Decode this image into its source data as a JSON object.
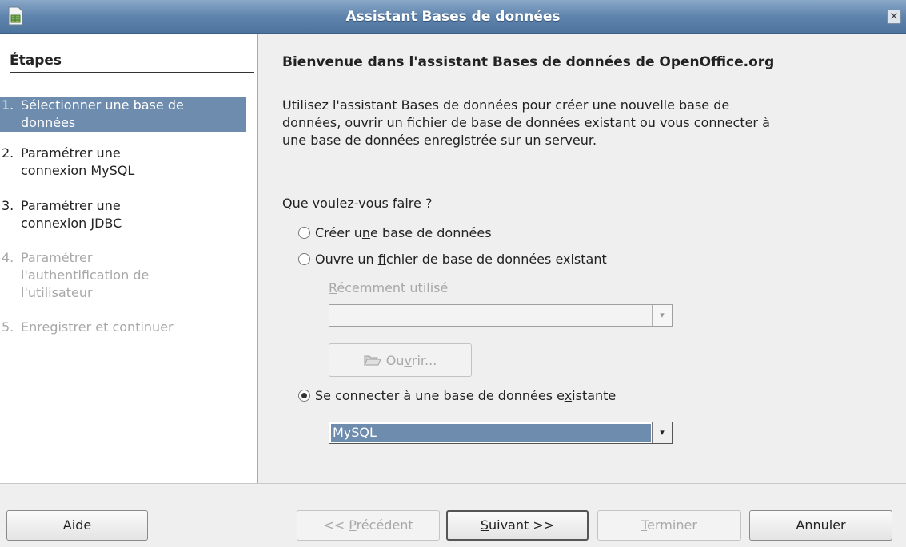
{
  "window": {
    "title": "Assistant Bases de données",
    "close_label": "×"
  },
  "steps": {
    "heading": "Étapes",
    "items": [
      {
        "num": "1.",
        "line1": "Sélectionner une base de",
        "line2": "données",
        "state": "active"
      },
      {
        "num": "2.",
        "line1": "Paramétrer une",
        "line2": "connexion MySQL",
        "state": "normal"
      },
      {
        "num": "3.",
        "line1": "Paramétrer une",
        "line2": "connexion JDBC",
        "state": "normal"
      },
      {
        "num": "4.",
        "line1": "Paramétrer",
        "line2": "l'authentification de",
        "line3": "l'utilisateur",
        "state": "disabled"
      },
      {
        "num": "5.",
        "line1": "Enregistrer et continuer",
        "state": "disabled"
      }
    ]
  },
  "main": {
    "title": "Bienvenue dans l'assistant Bases de données de OpenOffice.org",
    "intro_line1": "Utilisez l'assistant Bases de données pour créer une nouvelle base de",
    "intro_line2": "données, ouvrir un fichier de base de données existant ou vous connecter à",
    "intro_line3": "une base de données enregistrée sur un serveur.",
    "question": "Que voulez-vous faire ?",
    "options": {
      "create": {
        "pre": "Créer u",
        "mnemonic": "n",
        "post": "e base de données",
        "checked": false
      },
      "open": {
        "pre": "Ouvre un ",
        "mnemonic": "f",
        "post": "ichier de base de données existant",
        "checked": false
      },
      "connect": {
        "pre": "Se connecter à une base de données e",
        "mnemonic": "x",
        "post": "istante",
        "checked": true
      }
    },
    "recent": {
      "mnemonic": "R",
      "rest": "écemment utilisé",
      "value": ""
    },
    "open_button": {
      "pre": "Ou",
      "mnemonic": "v",
      "post": "rir..."
    },
    "db_type": {
      "value": "MySQL"
    }
  },
  "buttons": {
    "help": "Aide",
    "previous": {
      "pre": "<< ",
      "mnemonic": "P",
      "post": "récédent"
    },
    "next": {
      "pre": "",
      "mnemonic": "S",
      "post": "uivant >>"
    },
    "finish": {
      "pre": "",
      "mnemonic": "T",
      "post": "erminer"
    },
    "cancel": "Annuler"
  },
  "colors": {
    "titlebar": "#5f84ad",
    "selection": "#6e8cae",
    "disabled_text": "#a8a8a8"
  },
  "icons": {
    "app": "database-app-icon",
    "close": "close-icon",
    "open": "folder-open-icon",
    "dropdown": "chevron-down-icon",
    "radio": "radio-icon"
  }
}
